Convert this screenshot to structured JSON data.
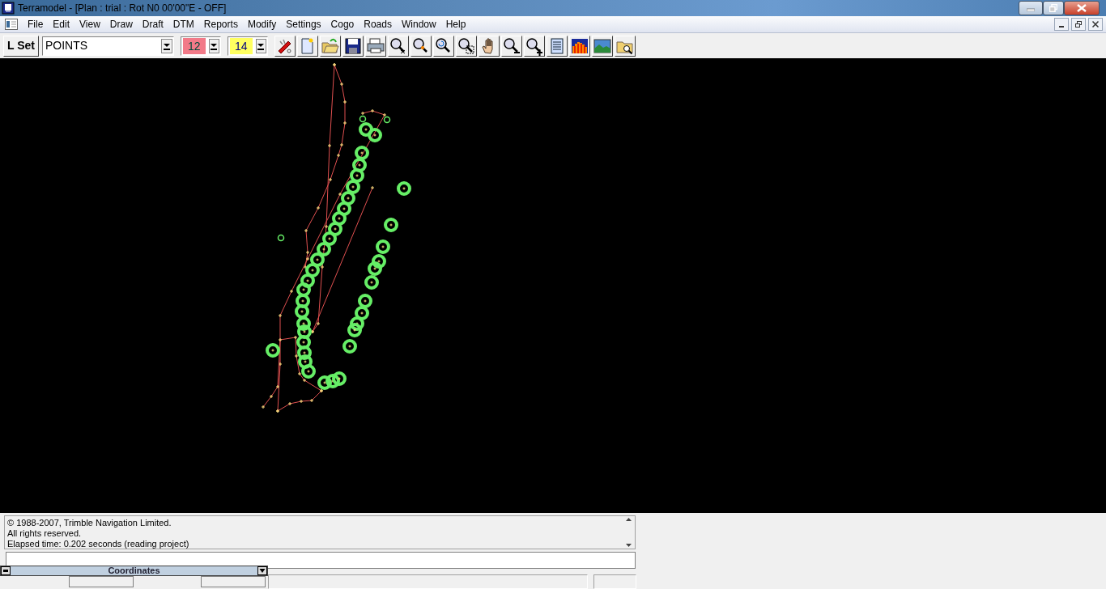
{
  "window": {
    "title": "Terramodel - [Plan : trial : Rot N0 00'00\"E - OFF]"
  },
  "menu": [
    "File",
    "Edit",
    "View",
    "Draw",
    "Draft",
    "DTM",
    "Reports",
    "Modify",
    "Settings",
    "Cogo",
    "Roads",
    "Window",
    "Help"
  ],
  "toolbar": {
    "layer_set_button": "L Set",
    "layer": "POINTS",
    "color_number": "12",
    "linetype_number": "14"
  },
  "messages": [
    "© 1988-2007, Trimble Navigation Limited.",
    "All rights reserved.",
    "Elapsed time: 0.202 seconds (reading project)"
  ],
  "coordinates_panel": {
    "title": "Coordinates"
  }
}
